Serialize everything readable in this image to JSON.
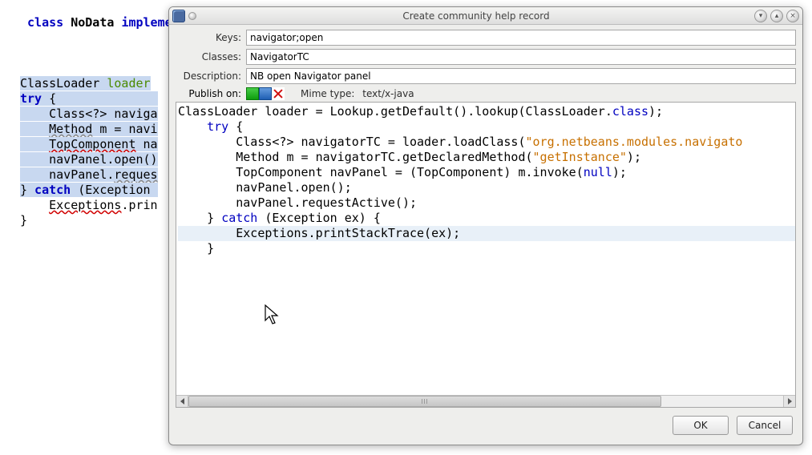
{
  "dialog": {
    "title": "Create community help record",
    "labels": {
      "keys": "Keys:",
      "classes": "Classes:",
      "description": "Description:",
      "publish_on": "Publish on:",
      "mime_type_label": "Mime type:"
    },
    "fields": {
      "keys": "navigator;open",
      "classes": "NavigatorTC",
      "description": "NB open Navigator panel"
    },
    "mime_type": "text/x-java",
    "buttons": {
      "ok": "OK",
      "cancel": "Cancel"
    }
  },
  "code_preview": {
    "lines": [
      {
        "t": [
          {
            "s": "ClassLoader loader = Lookup.getDefault().lookup(ClassLoader."
          },
          {
            "s": "class",
            "c": "ckw"
          },
          {
            "s": ");"
          }
        ]
      },
      {
        "t": [
          {
            "s": "    "
          },
          {
            "s": "try",
            "c": "ckw"
          },
          {
            "s": " {"
          }
        ]
      },
      {
        "t": [
          {
            "s": "        Class<?> navigatorTC = loader.loadClass("
          },
          {
            "s": "\"org.netbeans.modules.navigato",
            "c": "cstr"
          }
        ]
      },
      {
        "t": [
          {
            "s": "        Method m = navigatorTC.getDeclaredMethod("
          },
          {
            "s": "\"getInstance\"",
            "c": "cstr"
          },
          {
            "s": ");"
          }
        ]
      },
      {
        "t": [
          {
            "s": "        TopComponent navPanel = (TopComponent) m.invoke("
          },
          {
            "s": "null",
            "c": "ckw"
          },
          {
            "s": ");"
          }
        ]
      },
      {
        "t": [
          {
            "s": "        navPanel.open();"
          }
        ]
      },
      {
        "t": [
          {
            "s": "        navPanel.requestActive();"
          }
        ]
      },
      {
        "t": [
          {
            "s": "    } "
          },
          {
            "s": "catch",
            "c": "ckw"
          },
          {
            "s": " (Exception ex) {"
          }
        ]
      },
      {
        "hl": true,
        "t": [
          {
            "s": "        Exceptions.printStackTrace(ex);"
          }
        ]
      },
      {
        "t": [
          {
            "s": "    }"
          }
        ]
      }
    ]
  },
  "background_code": {
    "line0": " class NoData implements Serializable {",
    "lines": [
      "ClassLoader loader",
      "try {",
      "    Class<?> naviga",
      "    Method m = navi",
      "    TopComponent na",
      "    navPanel.open()",
      "    navPanel.reques",
      "} catch (Exception ",
      "    Exceptions.prin",
      "}"
    ]
  }
}
